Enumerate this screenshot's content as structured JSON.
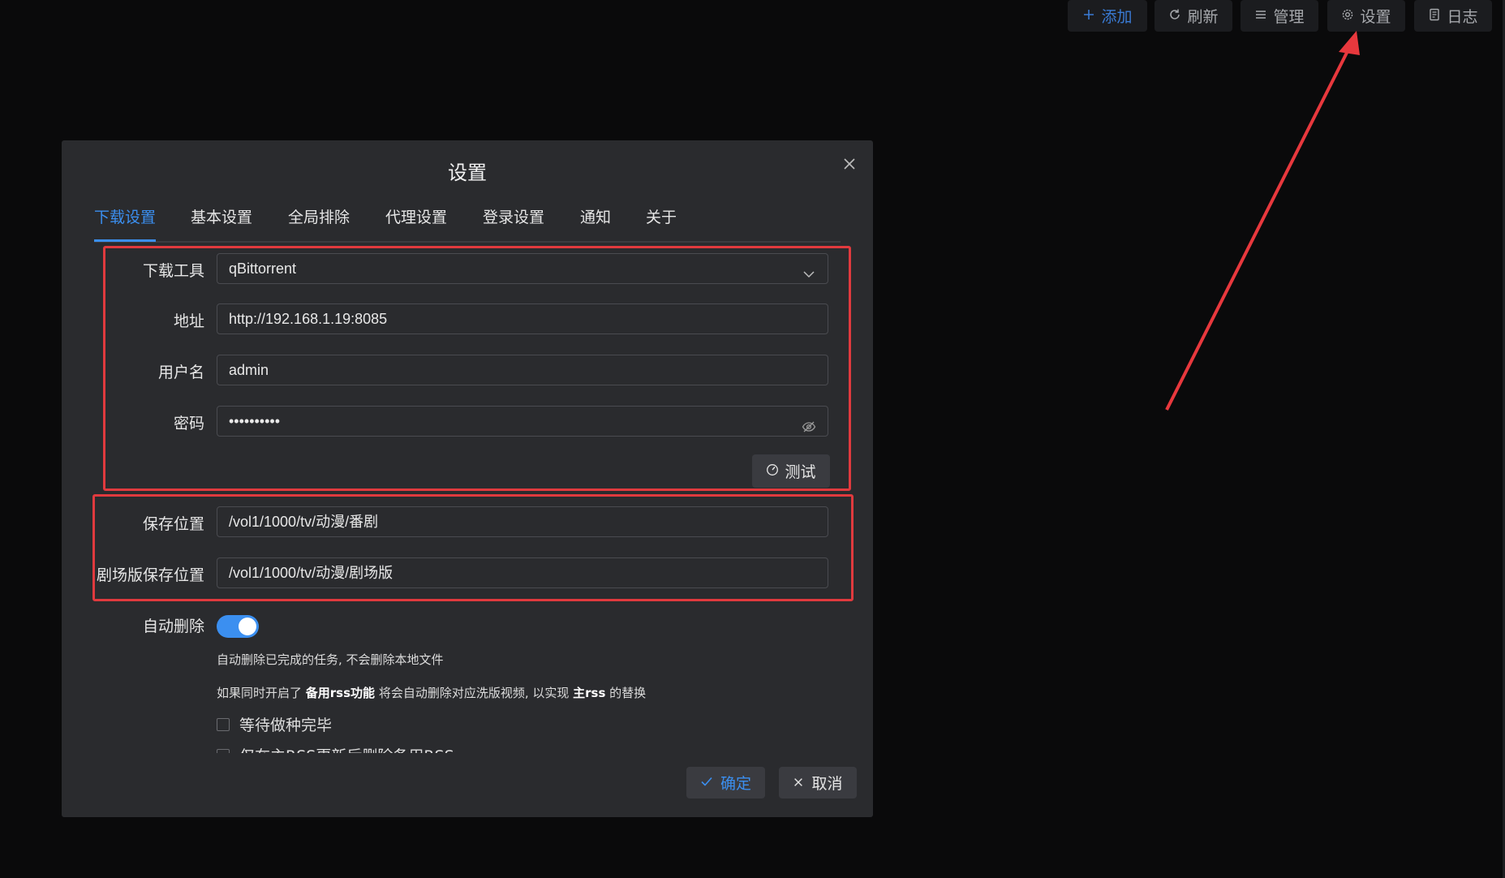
{
  "toolbar": {
    "add": "添加",
    "refresh": "刷新",
    "manage": "管理",
    "settings": "设置",
    "log": "日志"
  },
  "dialog": {
    "title": "设置",
    "tabs": [
      "下载设置",
      "基本设置",
      "全局排除",
      "代理设置",
      "登录设置",
      "通知",
      "关于"
    ],
    "active_tab": "下载设置",
    "fields": {
      "download_tool": {
        "label": "下载工具",
        "value": "qBittorrent"
      },
      "address": {
        "label": "地址",
        "value": "http://192.168.1.19:8085"
      },
      "username": {
        "label": "用户名",
        "value": "admin"
      },
      "password": {
        "label": "密码",
        "value": "••••••••••"
      },
      "save_path": {
        "label": "保存位置",
        "value": "/vol1/1000/tv/动漫/番剧"
      },
      "movie_save_path": {
        "label": "剧场版保存位置",
        "value": "/vol1/1000/tv/动漫/剧场版"
      },
      "auto_delete": {
        "label": "自动删除",
        "enabled": true
      }
    },
    "test_button": "测试",
    "hint1": "自动删除已完成的任务, 不会删除本地文件",
    "hint2": {
      "p1": "如果同时开启了 ",
      "b1": "备用rss功能",
      "p2": " 将会自动删除对应洗版视频, 以实现 ",
      "b2": "主rss",
      "p3": " 的替换"
    },
    "checkbox_wait_seed": "等待做种完毕",
    "checkbox_only_main": "仅在主RSS更新后删除备用RSS",
    "confirm": "确定",
    "cancel": "取消"
  },
  "colors": {
    "accent": "#3b8ff0",
    "highlight": "#e03a3e",
    "background": "#0a0a0b",
    "dialog": "#2a2b2e"
  }
}
